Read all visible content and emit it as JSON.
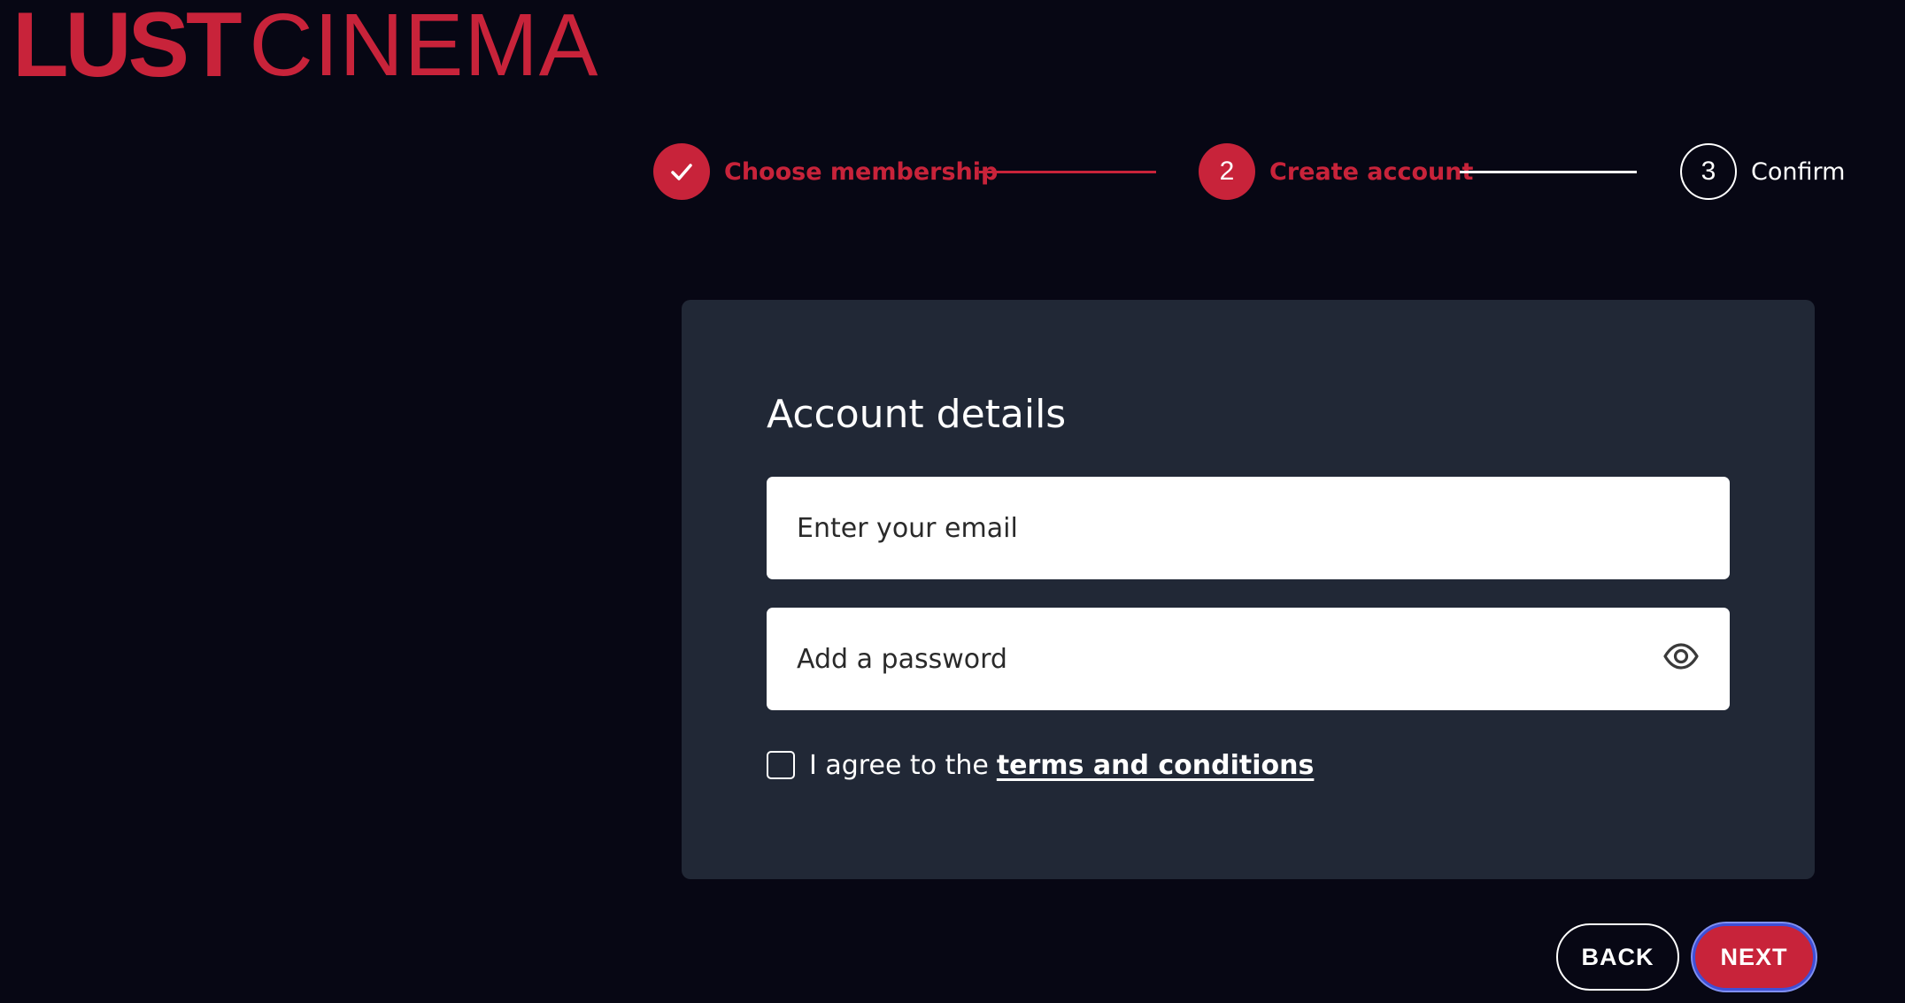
{
  "logo": {
    "bold_text": "LUST",
    "light_text": "CINEMA"
  },
  "stepper": {
    "steps": [
      {
        "number": "",
        "label": "Choose membership",
        "state": "complete"
      },
      {
        "number": "2",
        "label": "Create account",
        "state": "current"
      },
      {
        "number": "3",
        "label": "Confirm",
        "state": "upcoming"
      }
    ],
    "icons": {
      "complete": "check-icon"
    }
  },
  "form": {
    "title": "Account details",
    "email_placeholder": "Enter your email",
    "email_value": "",
    "password_placeholder": "Add a password",
    "password_value": "",
    "password_toggle_icon": "eye-icon",
    "agree_text": "I agree to the",
    "terms_link": "terms and conditions",
    "agree_checked": false
  },
  "actions": {
    "back_label": "BACK",
    "next_label": "NEXT"
  },
  "colors": {
    "background": "#070714",
    "accent": "#c8233a",
    "card": "#212836",
    "focus_ring": "#3f4fd6"
  }
}
